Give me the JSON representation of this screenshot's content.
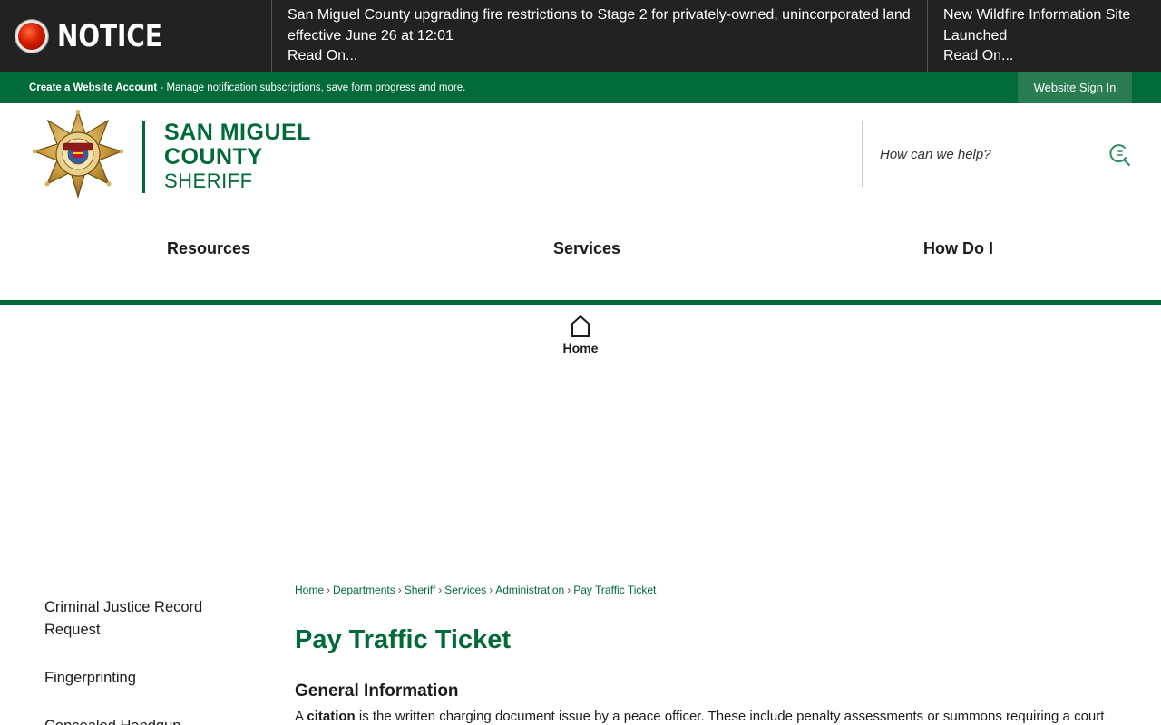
{
  "notice": {
    "label": "NOTICE",
    "items": [
      {
        "text": "San Miguel County upgrading fire restrictions to Stage 2 for privately-owned, unincorporated land effective June 26 at 12:01",
        "link": "Read On..."
      },
      {
        "text": "New Wildfire Information Site Launched",
        "link": "Read On..."
      }
    ]
  },
  "account_bar": {
    "create_label": "Create a Website Account",
    "description": " - Manage notification subscriptions, save form progress and more.",
    "signin_label": "Website Sign In"
  },
  "header": {
    "logo_line1": "SAN MIGUEL",
    "logo_line2": "COUNTY",
    "logo_line3": "SHERIFF",
    "search_placeholder": "How can we help?"
  },
  "nav": {
    "items": [
      "Resources",
      "Services",
      "How Do I"
    ]
  },
  "home": {
    "label": "Home"
  },
  "sidebar": {
    "items": [
      "Criminal Justice Record Request",
      "Fingerprinting",
      "Concealed Handgun"
    ]
  },
  "breadcrumb": [
    "Home",
    "Departments",
    "Sheriff",
    "Services",
    "Administration",
    "Pay Traffic Ticket"
  ],
  "content": {
    "title": "Pay Traffic Ticket",
    "section_title": "General Information",
    "body_prefix": "A ",
    "body_bold": "citation",
    "body_rest": " is the written charging document issue by a peace officer. These include penalty assessments or summons requiring a court"
  },
  "colors": {
    "brand_green": "#006a39",
    "notice_bg": "#222222"
  },
  "icons": {
    "notice": "red-alert-dot-icon",
    "search": "search-icon",
    "home": "home-icon",
    "badge": "sheriff-star-badge"
  }
}
